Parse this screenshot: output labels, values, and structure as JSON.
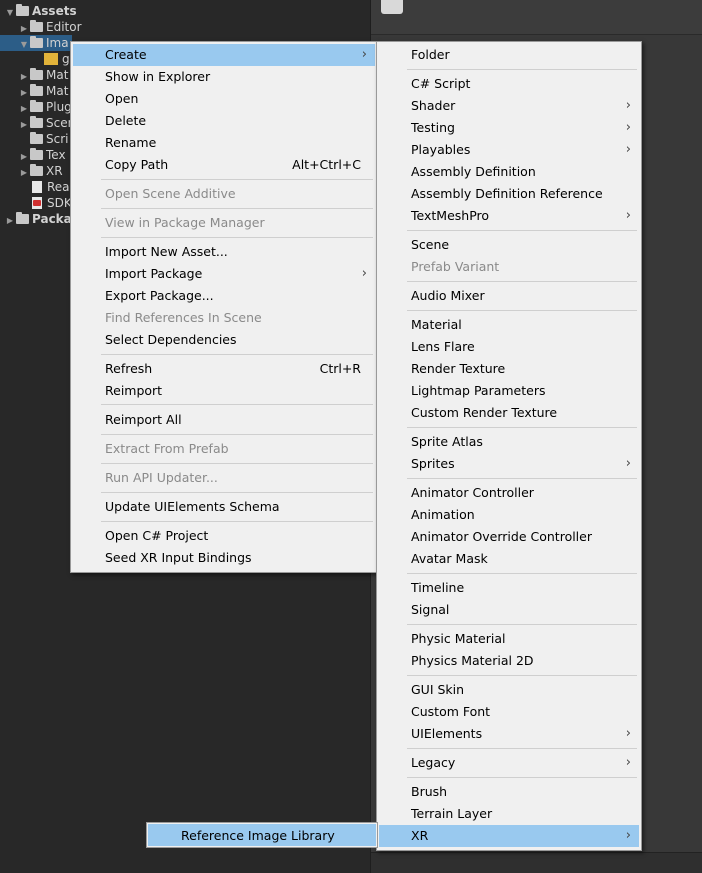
{
  "project_tree": {
    "assets": "Assets",
    "editor": "Editor",
    "images": "Ima",
    "image_file": "g",
    "materials": "Mat",
    "materials2": "Mat",
    "plugins": "Plug",
    "scenes": "Scen",
    "scripts": "Scri",
    "textures": "Tex",
    "xr": "XR",
    "readme": "Rea",
    "sdk": "SDK",
    "packages": "Packa"
  },
  "context_menu": {
    "items": [
      {
        "label": "Create",
        "submenu": true,
        "highlighted": true
      },
      {
        "label": "Show in Explorer"
      },
      {
        "label": "Open"
      },
      {
        "label": "Delete"
      },
      {
        "label": "Rename"
      },
      {
        "label": "Copy Path",
        "shortcut": "Alt+Ctrl+C"
      },
      {
        "label": "Open Scene Additive",
        "disabled": true
      },
      {
        "label": "View in Package Manager",
        "disabled": true
      },
      {
        "label": "Import New Asset..."
      },
      {
        "label": "Import Package",
        "submenu": true
      },
      {
        "label": "Export Package..."
      },
      {
        "label": "Find References In Scene",
        "disabled": true
      },
      {
        "label": "Select Dependencies"
      },
      {
        "label": "Refresh",
        "shortcut": "Ctrl+R"
      },
      {
        "label": "Reimport"
      },
      {
        "label": "Reimport All"
      },
      {
        "label": "Extract From Prefab",
        "disabled": true
      },
      {
        "label": "Run API Updater...",
        "disabled": true
      },
      {
        "label": "Update UIElements Schema"
      },
      {
        "label": "Open C# Project"
      },
      {
        "label": "Seed XR Input Bindings"
      }
    ]
  },
  "create_submenu": {
    "items": [
      {
        "label": "Folder"
      },
      {
        "label": "C# Script"
      },
      {
        "label": "Shader",
        "submenu": true
      },
      {
        "label": "Testing",
        "submenu": true
      },
      {
        "label": "Playables",
        "submenu": true
      },
      {
        "label": "Assembly Definition"
      },
      {
        "label": "Assembly Definition Reference"
      },
      {
        "label": "TextMeshPro",
        "submenu": true
      },
      {
        "label": "Scene"
      },
      {
        "label": "Prefab Variant",
        "disabled": true
      },
      {
        "label": "Audio Mixer"
      },
      {
        "label": "Material"
      },
      {
        "label": "Lens Flare"
      },
      {
        "label": "Render Texture"
      },
      {
        "label": "Lightmap Parameters"
      },
      {
        "label": "Custom Render Texture"
      },
      {
        "label": "Sprite Atlas"
      },
      {
        "label": "Sprites",
        "submenu": true
      },
      {
        "label": "Animator Controller"
      },
      {
        "label": "Animation"
      },
      {
        "label": "Animator Override Controller"
      },
      {
        "label": "Avatar Mask"
      },
      {
        "label": "Timeline"
      },
      {
        "label": "Signal"
      },
      {
        "label": "Physic Material"
      },
      {
        "label": "Physics Material 2D"
      },
      {
        "label": "GUI Skin"
      },
      {
        "label": "Custom Font"
      },
      {
        "label": "UIElements",
        "submenu": true
      },
      {
        "label": "Legacy",
        "submenu": true
      },
      {
        "label": "Brush"
      },
      {
        "label": "Terrain Layer"
      },
      {
        "label": "XR",
        "submenu": true,
        "highlighted": true
      }
    ]
  },
  "xr_submenu": {
    "item": "Reference Image Library"
  },
  "glyphs": {
    "submenu_arrow": "›",
    "expanded": "▼",
    "collapsed": "▶"
  },
  "colors": {
    "highlight": "#99c9ef",
    "menu_bg": "#f0f0f0",
    "panel_bg": "#282828",
    "selection": "#2c5d87"
  }
}
